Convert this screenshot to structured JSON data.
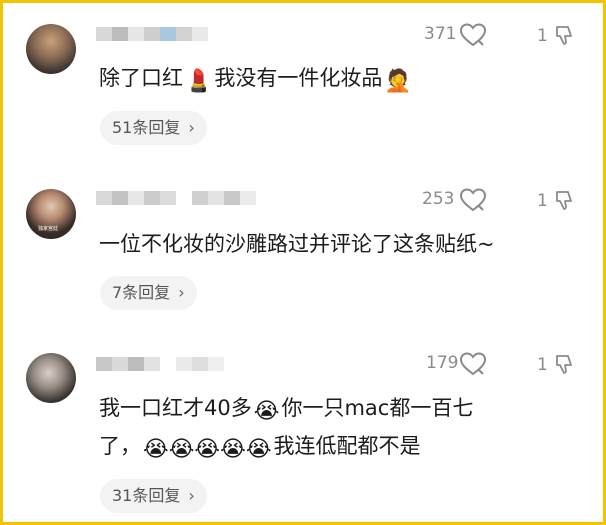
{
  "comments": [
    {
      "like_count": "371",
      "dislike_count": "1",
      "text": "除了口红",
      "emoji_1": "💄",
      "text_2": "我没有一件化妆品",
      "emoji_2": "🤦",
      "replies": "51条回复",
      "chevron": "›"
    },
    {
      "like_count": "253",
      "dislike_count": "1",
      "text": "一位不化妆的沙雕路过并评论了这条贴纸~",
      "avatar_caption": "独家宫廷",
      "replies": "7条回复",
      "chevron": "›"
    },
    {
      "like_count": "179",
      "dislike_count": "1",
      "line1_a": "我一口红才40多",
      "emoji_1": "😭",
      "line1_b": "你一只mac都一百七",
      "line2_a": "了，",
      "emojis": "😭😭😭😭😭",
      "line2_b": "我连低配都不是",
      "replies": "31条回复",
      "chevron": "›"
    }
  ],
  "colors": {
    "border": "#f5c400",
    "text": "#1c1c1c",
    "muted": "#8a8a8a",
    "pill": "#f3f3f3"
  },
  "icons": {
    "like": "heart-icon",
    "dislike": "thumbs-down-icon"
  }
}
